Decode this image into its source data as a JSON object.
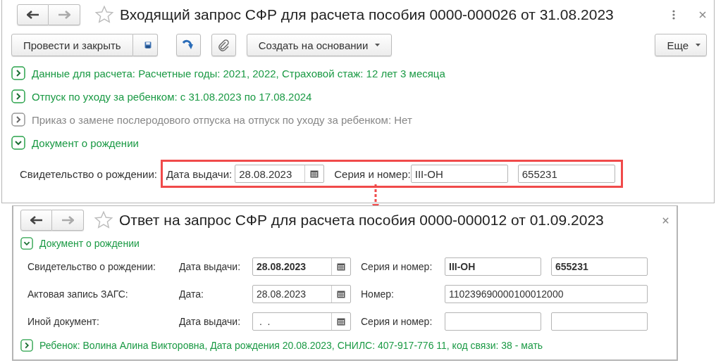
{
  "window": {
    "title": "Входящий запрос СФР для расчета пособия 0000-000026 от 31.08.2023"
  },
  "toolbar": {
    "post_close": "Провести и закрыть",
    "create_based_on": "Создать на основании",
    "more": "Еще"
  },
  "sections": [
    {
      "text": "Данные для расчета: Расчетные годы: 2021, 2022, Страховой стаж: 12 лет 3 месяца",
      "expanded": false,
      "dimmed": false
    },
    {
      "text": "Отпуск по уходу за ребенком: с 31.08.2023 по 17.08.2024",
      "expanded": false,
      "dimmed": false
    },
    {
      "text": "Приказ о замене послеродового отпуска на отпуск по уходу за ребенком: Нет",
      "expanded": false,
      "dimmed": true
    },
    {
      "text": "Документ о рождении",
      "expanded": true,
      "dimmed": false
    }
  ],
  "birth_certificate": {
    "label": "Свидетельство о рождении:",
    "date_label": "Дата выдачи:",
    "date": "28.08.2023",
    "series_label": "Серия и номер:",
    "series": "III-ОН",
    "number": "655231"
  },
  "response_window": {
    "title": "Ответ на запрос СФР для расчета пособия 0000-000012 от 01.09.2023",
    "section": {
      "text": "Документ о рождении",
      "expanded": true
    },
    "rows": [
      {
        "label": "Свидетельство о рождении:",
        "date_label": "Дата выдачи:",
        "date": "28.08.2023",
        "bold": true,
        "value_label": "Серия и номер:",
        "kind": "pair",
        "values": [
          "III-ОН",
          "655231"
        ]
      },
      {
        "label": "Актовая запись ЗАГС:",
        "date_label": "Дата:",
        "date": "28.08.2023",
        "bold": false,
        "value_label": "Номер:",
        "kind": "single",
        "values": [
          "110239690000100012000"
        ]
      },
      {
        "label": "Иной документ:",
        "date_label": "Дата выдачи:",
        "date": " .  .",
        "bold": false,
        "value_label": "Серия и номер:",
        "kind": "pair"
      }
    ],
    "child": {
      "text": "Ребенок: Волина Алина Викторовна, Дата рождения 20.08.2023, СНИЛС: 407-917-776 11, код связи: 38 - мать",
      "expanded": false
    }
  }
}
